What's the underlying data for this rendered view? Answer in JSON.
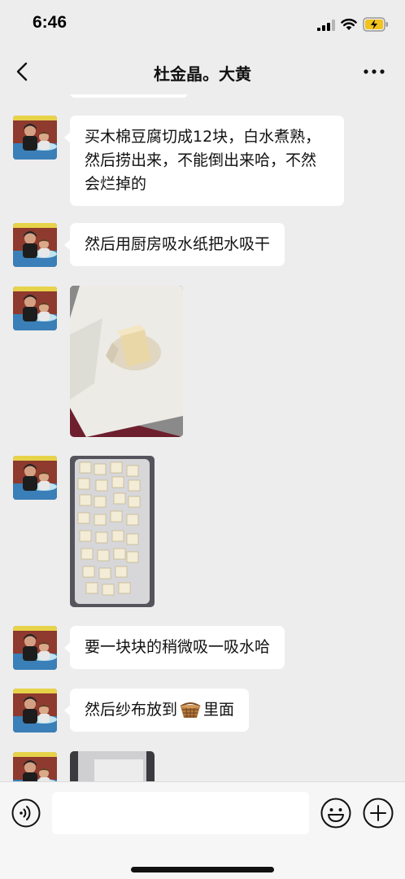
{
  "status": {
    "time": "6:46"
  },
  "header": {
    "title": "杜金晶。大黄"
  },
  "messages": [
    {
      "type": "text",
      "text": "买木棉豆腐切成12块，白水煮熟，然后捞出来，不能倒出来哈，不然会烂掉的"
    },
    {
      "type": "text",
      "text": "然后用厨房吸水纸把水吸干"
    },
    {
      "type": "image",
      "icon": "tofu-on-paper-towel-photo"
    },
    {
      "type": "image",
      "icon": "tofu-cubes-in-tray-photo"
    },
    {
      "type": "text",
      "text": "要一块块的稍微吸一吸水哈"
    },
    {
      "type": "text",
      "before": "然后纱布放到",
      "emoji": "basket-emoji",
      "after": "里面"
    },
    {
      "type": "image",
      "icon": "partial-photo"
    }
  ],
  "colors": {
    "background": "#ededed",
    "bubble": "#ffffff",
    "input_bar": "#f6f6f6"
  },
  "icons": {
    "back": "chevron-left-icon",
    "more": "more-dots-icon",
    "voice": "voice-icon",
    "emoji": "emoji-icon",
    "add": "plus-icon"
  }
}
